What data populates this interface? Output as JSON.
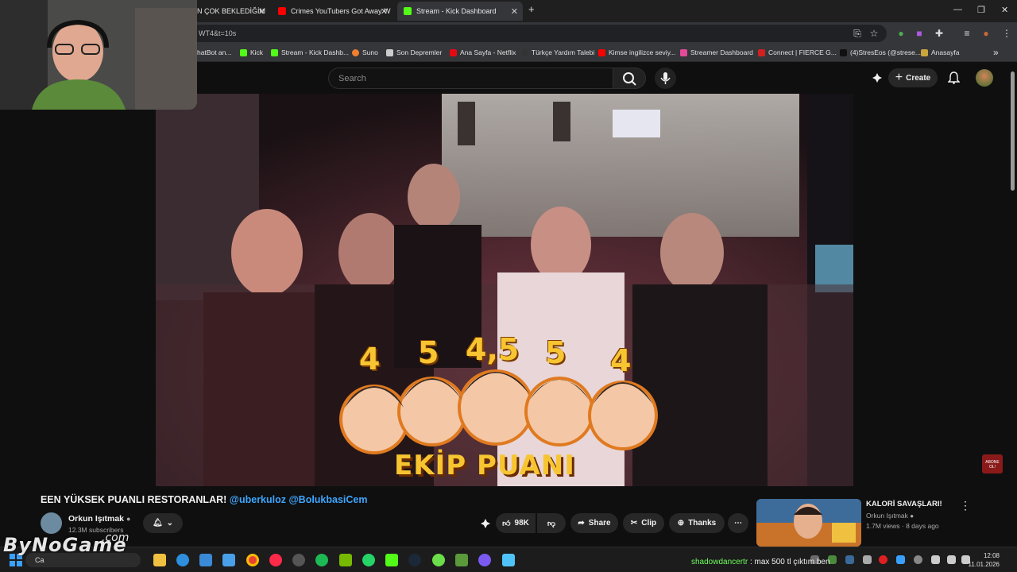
{
  "browser": {
    "tabs": [
      {
        "label": "N ÇOK BEKLEDİĞİM",
        "favicon_color": "#ff0000"
      },
      {
        "label": "Crimes YouTubers Got Away W",
        "favicon_color": "#ff0000"
      },
      {
        "label": "Stream - Kick Dashboard",
        "favicon_color": "#53fc18"
      }
    ],
    "new_tab_label": "+",
    "address": "WT4&t=10s",
    "bookmarks": [
      {
        "label": "hatBot an...",
        "color": "#777"
      },
      {
        "label": "Kick",
        "color": "#53fc18"
      },
      {
        "label": "Stream - Kick Dashb...",
        "color": "#53fc18"
      },
      {
        "label": "Suno",
        "color": "#f08030"
      },
      {
        "label": "Son Depremler",
        "color": "#cccccc"
      },
      {
        "label": "Ana Sayfa - Netflix",
        "color": "#e50914"
      },
      {
        "label": "Türkçe Yardım Talebi",
        "color": "#222222"
      },
      {
        "label": "Kimse ingilizce seviy...",
        "color": "#ff0000"
      },
      {
        "label": "Streamer Dashboard",
        "color": "#e44a9a"
      },
      {
        "label": "Connect | FIERCE G...",
        "color": "#d12020"
      },
      {
        "label": "(4)StresEos (@strese...",
        "color": "#111111"
      },
      {
        "label": "Anasayfa",
        "color": "#c9a53c"
      }
    ],
    "more_bookmarks": "»"
  },
  "youtube": {
    "search_placeholder": "Search",
    "create_label": "Create",
    "video": {
      "scores": [
        "4",
        "5",
        "4,5",
        "5",
        "4"
      ],
      "overlay_caption": "EKİP PUANI",
      "corner_badge": "ABONE OL!"
    },
    "title_main": "EEN YÜKSEK PUANLI RESTORANLAR!",
    "title_tags": "@uberkuloz @BolukbasiCem",
    "channel_name": "Orkun Işıtmak",
    "subscribers": "12.3M subscribers",
    "likes": "98K",
    "share_label": "Share",
    "clip_label": "Clip",
    "thanks_label": "Thanks",
    "recommended": {
      "title": "KALORİ SAVAŞLARI!",
      "channel": "Orkun Işıtmak",
      "meta": "1.7M views · 8 days ago"
    }
  },
  "overlay": {
    "chat_user": "shadowdancertr",
    "chat_message": ": max 500 tl çıktım ben",
    "watermark": "ByNoGame",
    "watermark_suffix": ".com"
  },
  "taskbar": {
    "search_text": "Ca",
    "time": "12:08",
    "date": "11.01.2026"
  }
}
